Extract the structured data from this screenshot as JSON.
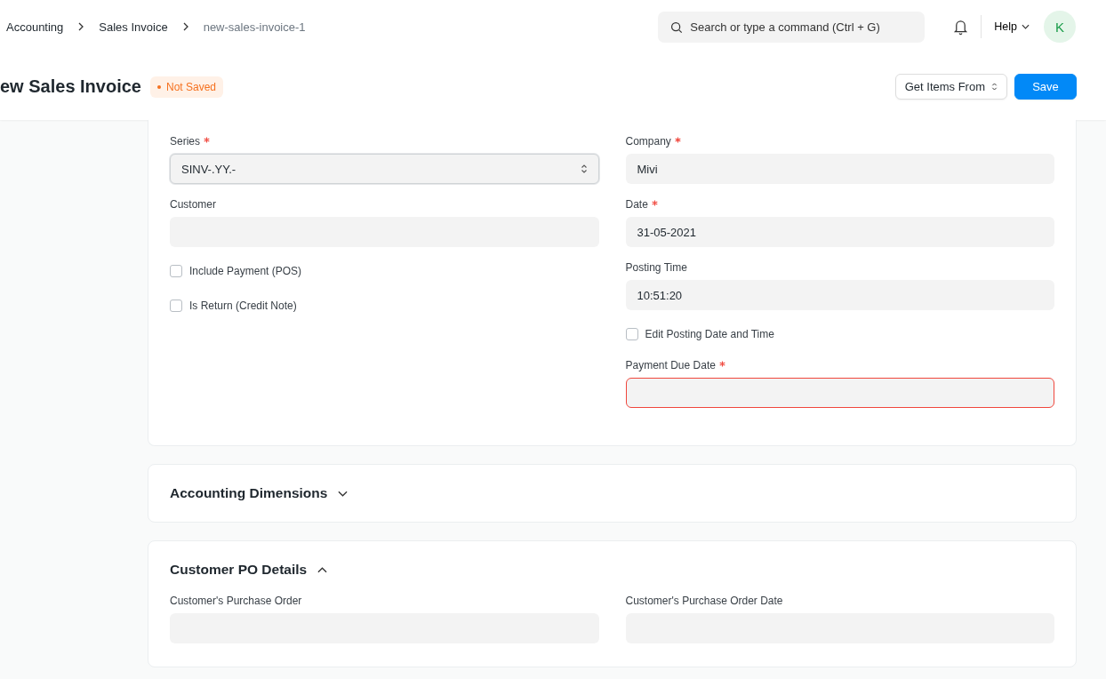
{
  "breadcrumbs": [
    {
      "label": "Accounting",
      "current": false
    },
    {
      "label": "Sales Invoice",
      "current": false
    },
    {
      "label": "new-sales-invoice-1",
      "current": true
    }
  ],
  "search": {
    "placeholder": "Search or type a command (Ctrl + G)"
  },
  "help": {
    "label": "Help"
  },
  "avatar": {
    "initial": "K"
  },
  "page": {
    "title": "ew Sales Invoice",
    "status": "Not Saved"
  },
  "actions": [
    {
      "label": "Get Items From",
      "kind": "dropdown"
    },
    {
      "label": "Save",
      "kind": "primary"
    }
  ],
  "main_form": {
    "columns": [
      [
        {
          "kind": "select",
          "label": "Series",
          "required": true,
          "value": "SINV-.YY.-",
          "error": false
        },
        {
          "kind": "input",
          "label": "Customer",
          "required": false,
          "error": false
        },
        {
          "kind": "check",
          "label": "Include Payment (POS)",
          "checked": false
        },
        {
          "kind": "check",
          "label": "Is Return (Credit Note)",
          "checked": false
        }
      ],
      [
        {
          "kind": "input",
          "label": "Company",
          "required": true,
          "value": "Mivi",
          "error": false
        },
        {
          "kind": "input",
          "label": "Date",
          "required": true,
          "value": "31-05-2021",
          "error": false
        },
        {
          "kind": "input",
          "label": "Posting Time",
          "required": false,
          "value": "10:51:20",
          "error": false
        },
        {
          "kind": "check",
          "label": "Edit Posting Date and Time",
          "checked": false
        },
        {
          "kind": "input",
          "label": "Payment Due Date",
          "required": true,
          "error": true
        }
      ]
    ]
  },
  "sections": [
    {
      "title": "Accounting Dimensions",
      "expanded": false
    },
    {
      "title": "Customer PO Details",
      "expanded": true,
      "fields": [
        {
          "kind": "input",
          "label": "Customer's Purchase Order",
          "required": false,
          "error": false
        },
        {
          "kind": "input",
          "label": "Customer's Purchase Order Date",
          "required": false,
          "error": false
        }
      ]
    }
  ]
}
